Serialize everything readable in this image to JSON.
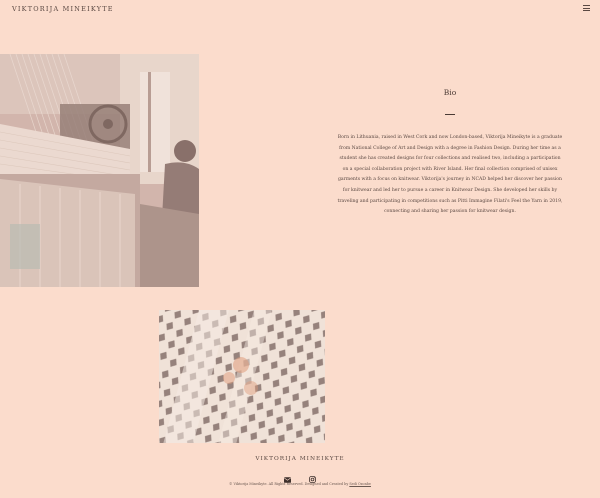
{
  "header": {
    "brand": "VIKTORIJA MINEIKYTE",
    "menu_icon": "hamburger-menu-icon"
  },
  "images": {
    "loom": {
      "subject": "weaving loom with weaver",
      "tint": "#c9a59a"
    },
    "lace": {
      "subject": "close-up lace textile",
      "tint": "#e8d8cc"
    }
  },
  "bio": {
    "title": "Bio",
    "text": "Born in Lithuania, raised in West Cork and now London-based, Viktorija Mineikyte is a graduate from National College of Art and Design with a degree in Fashion Design. During her time as a student she has created designs for four collections and realised two, including a participation on a special collaboration project with River Island. Her final collection comprised of unisex garments with a focus on knitwear. Viktorija's journey in NCAD helped her discover her passion for knitwear and led her to pursue a career in Knitwear Design. She developed her skills by traveling and participating in competitions such as Pitti Immagine Filati's Feel the Yarn in 2019, connecting and sharing her passion for knitwear design."
  },
  "footer": {
    "brand": "VIKTORIJA MINEIKYTE",
    "icons": [
      "envelope-icon",
      "instagram-icon"
    ],
    "copyright_prefix": "© Viktorija Mineikyte. All Rights Reserved. Designed and Created by",
    "copyright_link": "Sedi Ozonbe"
  },
  "colors": {
    "background": "#fbdccc",
    "text": "#4a3a34"
  }
}
